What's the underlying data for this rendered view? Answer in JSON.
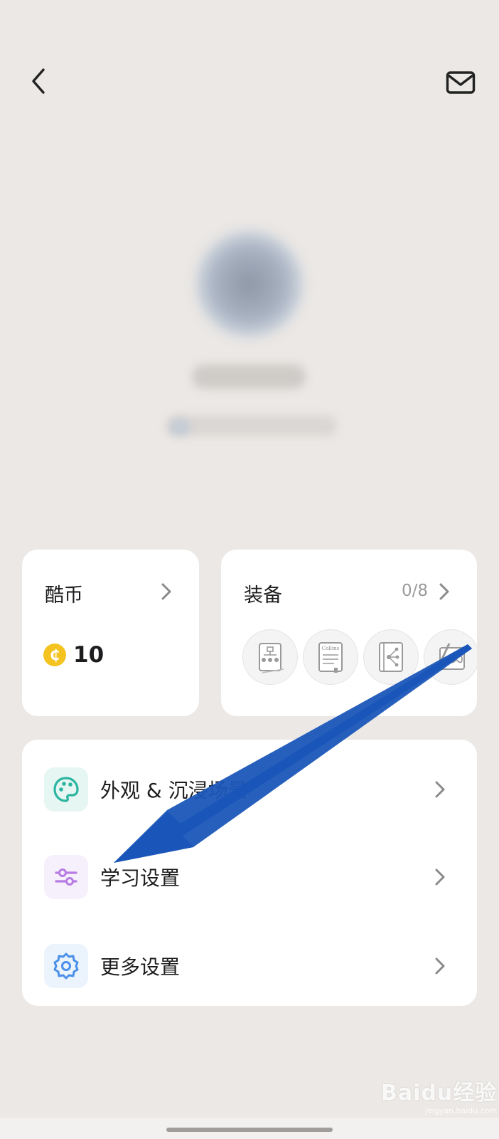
{
  "header": {
    "back_icon": "chevron-left-icon",
    "mail_icon": "mail-icon"
  },
  "coin_card": {
    "title": "酷币",
    "icon_glyph": "₵",
    "value": "10",
    "coin_color": "#f5c320"
  },
  "equip_card": {
    "title": "装备",
    "count": "0/8",
    "items": [
      "mindmap-book-icon",
      "collins-dictionary-icon",
      "tree-book-icon",
      "pencil-infinity-icon"
    ],
    "collins_text": "Collins"
  },
  "menu": {
    "items": [
      {
        "label": "外观 & 沉浸场景",
        "icon": "palette-icon",
        "color": "#2bb5a0"
      },
      {
        "label": "学习设置",
        "icon": "sliders-icon",
        "color": "#b77be3"
      },
      {
        "label": "更多设置",
        "icon": "gear-icon",
        "color": "#4a8fe8"
      }
    ]
  },
  "annotation": {
    "arrow_color": "#1a56b8"
  },
  "watermark": {
    "brand": "Baidu经验",
    "url": "jingyan.baidu.com"
  }
}
